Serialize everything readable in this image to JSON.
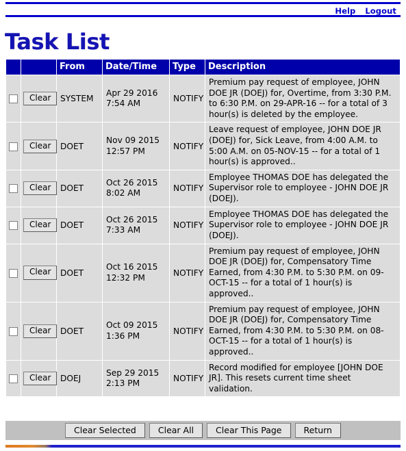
{
  "topbar": {
    "links": [
      {
        "label": "Help",
        "name": "help-link"
      },
      {
        "label": "Logout",
        "name": "logout-link"
      }
    ]
  },
  "page": {
    "title": "Task List",
    "title_color": "#1414b4",
    "header_bg": "#0000aa",
    "row_bg": "#dcdcdc",
    "actionbar_bg": "#c0c0c0"
  },
  "table": {
    "columns": [
      "",
      "",
      "From",
      "Date/Time",
      "Type",
      "Description"
    ],
    "clear_button_label": "Clear",
    "rows": [
      {
        "checked": false,
        "from": "SYSTEM",
        "date": "Apr 29 2016",
        "time": "7:54 AM",
        "type": "NOTIFY",
        "description": "Premium pay request of employee, JOHN DOE JR (DOEJ) for, Overtime, from 3:30 P.M. to 6:30 P.M. on 29-APR-16 -- for a total of 3 hour(s) is deleted by the employee."
      },
      {
        "checked": false,
        "from": "DOET",
        "date": "Nov 09 2015",
        "time": "12:57 PM",
        "type": "NOTIFY",
        "description": "Leave request of employee, JOHN DOE JR (DOEJ) for, Sick Leave, from 4:00 A.M. to 5:00 A.M. on 05-NOV-15 -- for a total of 1 hour(s) is approved.."
      },
      {
        "checked": false,
        "from": "DOET",
        "date": "Oct 26 2015",
        "time": "8:02 AM",
        "type": "NOTIFY",
        "description": "Employee THOMAS DOE has delegated the Supervisor role to employee - JOHN DOE JR (DOEJ)."
      },
      {
        "checked": false,
        "from": "DOET",
        "date": "Oct 26 2015",
        "time": "7:33 AM",
        "type": "NOTIFY",
        "description": "Employee THOMAS DOE has delegated the Supervisor role to employee - JOHN DOE JR (DOEJ)."
      },
      {
        "checked": false,
        "from": "DOET",
        "date": "Oct 16 2015",
        "time": "12:32 PM",
        "type": "NOTIFY",
        "description": "Premium pay request of employee, JOHN DOE JR (DOEJ) for, Compensatory Time Earned, from 4:30 P.M. to 5:30 P.M. on 09-OCT-15 -- for a total of 1 hour(s) is approved.."
      },
      {
        "checked": false,
        "from": "DOET",
        "date": "Oct 09 2015",
        "time": "1:36 PM",
        "type": "NOTIFY",
        "description": "Premium pay request of employee, JOHN DOE JR (DOEJ) for, Compensatory Time Earned, from 4:30 P.M. to 5:30 P.M. on 08-OCT-15 -- for a total of 1 hour(s) is approved.."
      },
      {
        "checked": false,
        "from": "DOEJ",
        "date": "Sep 29 2015",
        "time": "2:13 PM",
        "type": "NOTIFY",
        "description": "Record modified for employee [JOHN DOE JR]. This resets current time sheet validation."
      }
    ]
  },
  "actionbar": {
    "buttons": [
      {
        "label": "Clear Selected",
        "name": "clear-selected-button"
      },
      {
        "label": "Clear All",
        "name": "clear-all-button"
      },
      {
        "label": "Clear This Page",
        "name": "clear-this-page-button"
      },
      {
        "label": "Return",
        "name": "return-button"
      }
    ]
  }
}
